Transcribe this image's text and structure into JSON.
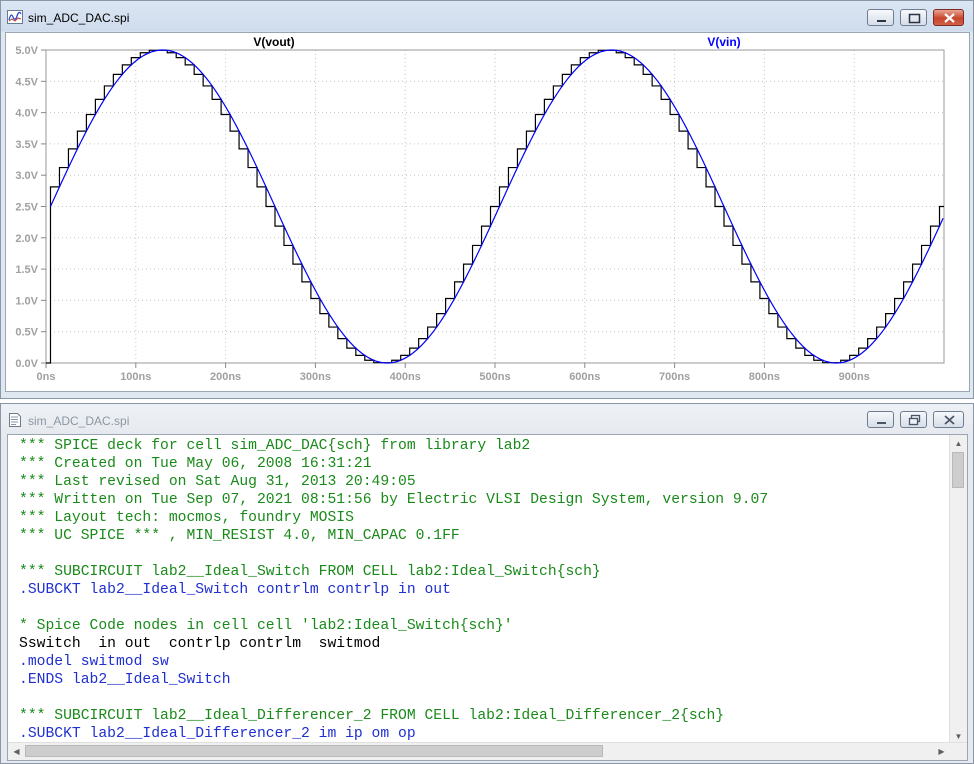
{
  "waveform_window": {
    "title": "sim_ADC_DAC.spi",
    "minimize_icon": "minimize-icon",
    "maximize_icon": "maximize-icon",
    "close_icon": "close-icon",
    "app_icon": "waveform-viewer-icon"
  },
  "chart_data": {
    "type": "line",
    "traces": [
      {
        "name": "V(vout)",
        "color": "#000000",
        "style": "staircase",
        "start_x": 5,
        "step_ns": 10,
        "initial_value": 0
      },
      {
        "name": "V(vin)",
        "color": "#0000ff",
        "style": "sine",
        "offset": 2.5,
        "amplitude": 2.5,
        "period_ns": 500
      }
    ],
    "x_ticks": [
      "0ns",
      "100ns",
      "200ns",
      "300ns",
      "400ns",
      "500ns",
      "600ns",
      "700ns",
      "800ns",
      "900ns"
    ],
    "y_ticks": [
      "0.0V",
      "0.5V",
      "1.0V",
      "1.5V",
      "2.0V",
      "2.5V",
      "3.0V",
      "3.5V",
      "4.0V",
      "4.5V",
      "5.0V"
    ],
    "xlim": [
      0,
      1000
    ],
    "ylim": [
      0,
      5
    ],
    "grid": true
  },
  "netlist_window": {
    "title": "sim_ADC_DAC.spi",
    "app_icon": "document-icon",
    "lines": [
      {
        "text": "*** SPICE deck for cell sim_ADC_DAC{sch} from library lab2",
        "color": "green"
      },
      {
        "text": "*** Created on Tue May 06, 2008 16:31:21",
        "color": "green"
      },
      {
        "text": "*** Last revised on Sat Aug 31, 2013 20:49:05",
        "color": "green"
      },
      {
        "text": "*** Written on Tue Sep 07, 2021 08:51:56 by Electric VLSI Design System, version 9.07",
        "color": "green"
      },
      {
        "text": "*** Layout tech: mocmos, foundry MOSIS",
        "color": "green"
      },
      {
        "text": "*** UC SPICE *** , MIN_RESIST 4.0, MIN_CAPAC 0.1FF",
        "color": "green"
      },
      {
        "text": "",
        "color": "black"
      },
      {
        "text": "*** SUBCIRCUIT lab2__Ideal_Switch FROM CELL lab2:Ideal_Switch{sch}",
        "color": "green"
      },
      {
        "text": ".SUBCKT lab2__Ideal_Switch contrlm contrlp in out",
        "color": "blue"
      },
      {
        "text": "",
        "color": "black"
      },
      {
        "text": "* Spice Code nodes in cell cell 'lab2:Ideal_Switch{sch}'",
        "color": "green"
      },
      {
        "text": "Sswitch  in out  contrlp contrlm  switmod",
        "color": "black"
      },
      {
        "text": ".model switmod sw",
        "color": "blue"
      },
      {
        "text": ".ENDS lab2__Ideal_Switch",
        "color": "blue"
      },
      {
        "text": "",
        "color": "black"
      },
      {
        "text": "*** SUBCIRCUIT lab2__Ideal_Differencer_2 FROM CELL lab2:Ideal_Differencer_2{sch}",
        "color": "green"
      },
      {
        "text": ".SUBCKT lab2__Ideal_Differencer_2 im ip om op",
        "color": "blue"
      }
    ]
  }
}
